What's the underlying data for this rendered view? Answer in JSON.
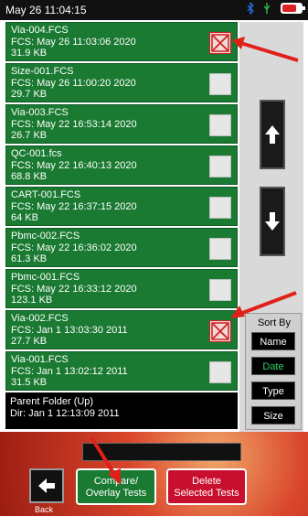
{
  "status": {
    "time": "May 26 11:04:15",
    "icons": [
      "bluetooth-icon",
      "usb-icon",
      "battery-icon"
    ]
  },
  "files": [
    {
      "name": "Via-004.FCS",
      "fcs": "FCS: May 26 11:03:06 2020",
      "size": "31.9 KB",
      "checked": true
    },
    {
      "name": "Size-001.FCS",
      "fcs": "FCS: May 26 11:00:20 2020",
      "size": "29.7 KB",
      "checked": false
    },
    {
      "name": "Via-003.FCS",
      "fcs": "FCS: May 22 16:53:14 2020",
      "size": "26.7 KB",
      "checked": false
    },
    {
      "name": "QC-001.fcs",
      "fcs": "FCS: May 22 16:40:13 2020",
      "size": "68.8 KB",
      "checked": false
    },
    {
      "name": "CART-001.FCS",
      "fcs": "FCS: May 22 16:37:15 2020",
      "size": "64 KB",
      "checked": false
    },
    {
      "name": "Pbmc-002.FCS",
      "fcs": "FCS: May 22 16:36:02 2020",
      "size": "61.3 KB",
      "checked": false
    },
    {
      "name": "Pbmc-001.FCS",
      "fcs": "FCS: May 22 16:33:12 2020",
      "size": "123.1 KB",
      "checked": false
    },
    {
      "name": "Via-002.FCS",
      "fcs": "FCS: Jan  1 13:03:30 2011",
      "size": "27.7 KB",
      "checked": true
    },
    {
      "name": "Via-001.FCS",
      "fcs": "FCS: Jan  1 13:02:12 2011",
      "size": "31.5 KB",
      "checked": false
    }
  ],
  "parent": {
    "title": "Parent Folder (Up)",
    "dir": "Dir: Jan  1 12:13:09 2011"
  },
  "sort": {
    "title": "Sort By",
    "options": [
      "Name",
      "Date",
      "Type",
      "Size"
    ],
    "active": "Date"
  },
  "bottom": {
    "back_label": "Back",
    "compare_label": "Compare/\nOverlay Tests",
    "delete_label": "Delete\nSelected Tests"
  },
  "colors": {
    "row_green": "#1a7a32",
    "delete_red": "#c8102e",
    "annotation_red": "#e0201a",
    "active_sort": "#2fd36a"
  }
}
